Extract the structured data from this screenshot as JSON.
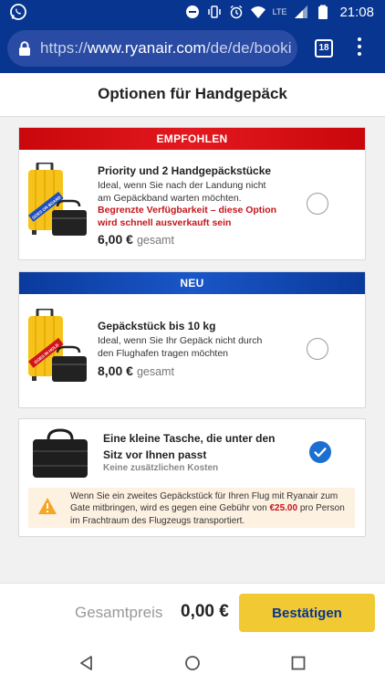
{
  "status_bar": {
    "time": "21:08",
    "network": "LTE",
    "icons": [
      "whatsapp-icon",
      "do-not-disturb-icon",
      "vibrate-icon",
      "alarm-icon",
      "wifi-icon",
      "signal-icon",
      "battery-icon"
    ]
  },
  "browser": {
    "url_prefix": "https://",
    "url_host": "www.ryanair.com",
    "url_path": "/de/de/booki",
    "tab_count": "18"
  },
  "page": {
    "title": "Optionen für Handgepäck"
  },
  "options": [
    {
      "ribbon": "EMPFOHLEN",
      "title": "Priority und 2 Handgepäckstücke",
      "description": "Ideal, wenn Sie nach der Landung nicht am Gepäckband warten möchten.",
      "warning": "Begrenzte Verfügbarkeit – diese Option wird schnell ausverkauft sein",
      "price": "6,00 €",
      "price_suffix": "gesamt",
      "luggage_tag": "GOES ON BOARD",
      "selected": false
    },
    {
      "ribbon": "NEU",
      "title": "Gepäckstück bis 10 kg",
      "description": "Ideal, wenn Sie Ihr Gepäck nicht durch den Flughafen tragen möchten",
      "price": "8,00 €",
      "price_suffix": "gesamt",
      "luggage_tag": "GOES IN HOLD",
      "selected": false
    },
    {
      "title": "Eine kleine Tasche, die unter den Sitz vor Ihnen passt",
      "subtitle": "Keine zusätzlichen Kosten",
      "selected": true
    }
  ],
  "notice": {
    "text_before": "Wenn Sie ein zweites Gepäckstück für Ihren Flug mit Ryanair zum Gate mitbringen, wird es gegen eine Gebühr von ",
    "fee": "€25.00",
    "text_after": " pro Person im Frachtraum des Flugzeugs transportiert."
  },
  "footer": {
    "total_label": "Gesamtpreis",
    "total_value": "0,00 €",
    "confirm_label": "Bestätigen"
  },
  "colors": {
    "brand_blue": "#073590",
    "ribbon_red": "#e2191e",
    "ribbon_blue": "#1a56c8",
    "confirm_yellow": "#f1c933",
    "warning_red": "#c4161c",
    "check_blue": "#1a6fd1",
    "notice_bg": "#fdf1e2",
    "warning_orange": "#f5a623"
  }
}
